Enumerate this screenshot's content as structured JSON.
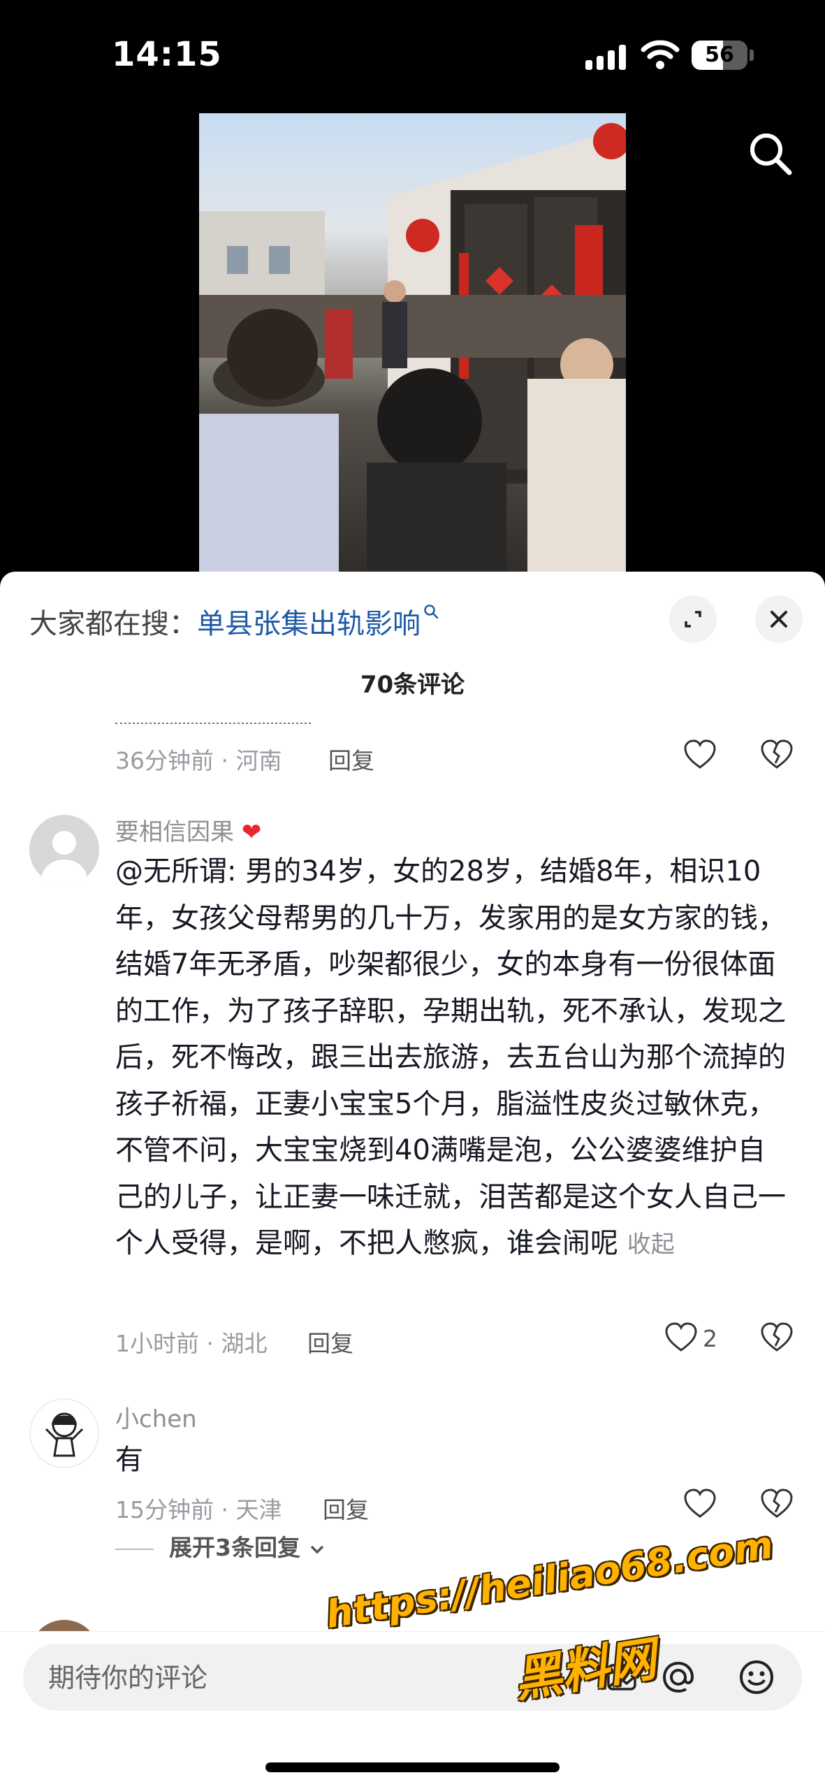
{
  "status_bar": {
    "time": "14:15",
    "battery": "56",
    "battery_level": 0.56
  },
  "colors": {
    "link_blue": "#1f5aa6",
    "heart_red": "#e8262b",
    "watermark": "#ffb300"
  },
  "sheet": {
    "search_prefix": "大家都在搜：",
    "search_term": "单县张集出轨影响",
    "comment_count": "70条评论"
  },
  "comments": [
    {
      "time_location": "36分钟前 · 河南",
      "reply_label": "回复"
    },
    {
      "username": "要相信因果",
      "username_emoji": "❤️",
      "text": "@无所谓: 男的34岁，女的28岁，结婚8年，相识10年，女孩父母帮男的几十万，发家用的是女方家的钱，结婚7年无矛盾，吵架都很少，女的本身有一份很体面的工作，为了孩子辞职，孕期出轨，死不承认，发现之后，死不悔改，跟三出去旅游，去五台山为那个流掉的孩子祈福，正妻小宝宝5个月，脂溢性皮炎过敏休克，不管不问，大宝宝烧到40满嘴是泡，公公婆婆维护自己的儿子，让正妻一味迁就，泪苦都是这个女人自己一个人受得，是啊，不把人憋疯，谁会闹呢",
      "collapse_label": "收起",
      "time_location": "1小时前 · 湖北",
      "reply_label": "回复",
      "likes": "2"
    },
    {
      "username": "小chen",
      "text": "有",
      "time_location": "15分钟前 · 天津",
      "reply_label": "回复",
      "expand_label": "展开3条回复"
    }
  ],
  "input": {
    "placeholder": "期待你的评论"
  },
  "watermark": {
    "url": "https://heiliao68.com",
    "name": "黑料网"
  },
  "icons": [
    "search-icon",
    "expand-icon",
    "close-icon",
    "heart-icon",
    "dislike-icon",
    "at-icon",
    "emoji-icon",
    "chevron-down-icon"
  ]
}
